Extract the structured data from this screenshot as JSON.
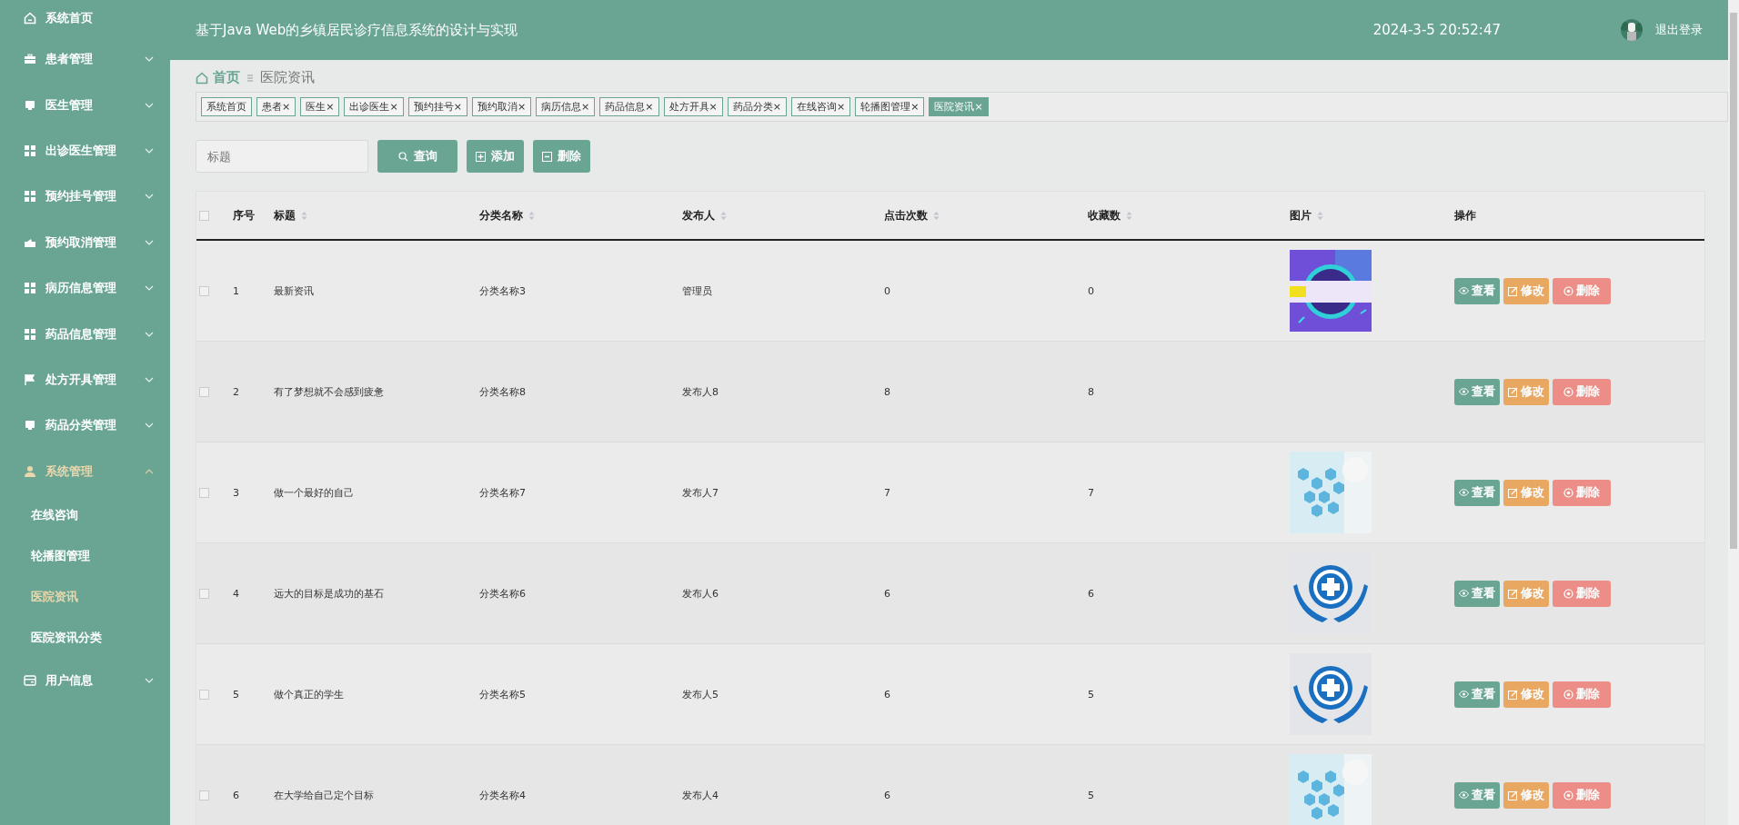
{
  "header": {
    "title": "基于Java Web的乡镇居民诊疗信息系统的设计与实现",
    "datetime": "2024-3-5 20:52:47",
    "logout": "退出登录"
  },
  "sidebar": {
    "items": [
      {
        "label": "系统首页"
      },
      {
        "label": "患者管理",
        "expanded": false
      },
      {
        "label": "医生管理",
        "expanded": false
      },
      {
        "label": "出诊医生管理",
        "expanded": false
      },
      {
        "label": "预约挂号管理",
        "expanded": false
      },
      {
        "label": "预约取消管理",
        "expanded": false
      },
      {
        "label": "病历信息管理",
        "expanded": false
      },
      {
        "label": "药品信息管理",
        "expanded": false
      },
      {
        "label": "处方开具管理",
        "expanded": false
      },
      {
        "label": "药品分类管理",
        "expanded": false
      },
      {
        "label": "系统管理",
        "expanded": true,
        "children": [
          {
            "label": "在线咨询",
            "selected": false
          },
          {
            "label": "轮播图管理",
            "selected": false
          },
          {
            "label": "医院资讯",
            "selected": true
          },
          {
            "label": "医院资讯分类",
            "selected": false
          }
        ]
      },
      {
        "label": "用户信息",
        "expanded": false
      }
    ]
  },
  "breadcrumb": [
    {
      "label": "首页"
    },
    {
      "label": "医院资讯"
    }
  ],
  "tags": [
    {
      "label": "系统首页",
      "selected": false
    },
    {
      "label": "患者",
      "close": "×",
      "selected": false
    },
    {
      "label": "医生",
      "close": "×",
      "selected": false
    },
    {
      "label": "出诊医生",
      "close": "×",
      "selected": false
    },
    {
      "label": "预约挂号",
      "close": "×",
      "selected": false
    },
    {
      "label": "预约取消",
      "close": "×",
      "selected": false
    },
    {
      "label": "病历信息",
      "close": "×",
      "selected": false
    },
    {
      "label": "药品信息",
      "close": "×",
      "selected": false
    },
    {
      "label": "处方开具",
      "close": "×",
      "selected": false
    },
    {
      "label": "药品分类",
      "close": "×",
      "selected": false
    },
    {
      "label": "在线咨询",
      "close": "×",
      "selected": false
    },
    {
      "label": "轮播图管理",
      "close": "×",
      "selected": false
    },
    {
      "label": "医院资讯",
      "close": "×",
      "selected": true
    }
  ],
  "search": {
    "placeholder": "标题",
    "buttons": [
      {
        "label": "查询",
        "kind": "search"
      },
      {
        "label": "添加",
        "kind": "add"
      },
      {
        "label": "删除",
        "kind": "delete"
      }
    ]
  },
  "table": {
    "all_checked": false,
    "columns": [
      {
        "label": "序号",
        "sortable": false
      },
      {
        "label": "标题",
        "sortable": true
      },
      {
        "label": "分类名称",
        "sortable": true
      },
      {
        "label": "发布人",
        "sortable": true
      },
      {
        "label": "点击次数",
        "sortable": true
      },
      {
        "label": "收藏数",
        "sortable": true
      },
      {
        "label": "图片",
        "sortable": true
      },
      {
        "label": "操作",
        "sortable": false
      }
    ],
    "rows": [
      {
        "checked": false,
        "index": "1",
        "title": "最新资讯",
        "category": "分类名称3",
        "publisher": "管理员",
        "clicks": "0",
        "favorites": "0",
        "image": {
          "kind": "picture"
        },
        "actions": [
          {
            "label": "查看",
            "kind": "view"
          },
          {
            "label": "修改",
            "kind": "edit"
          },
          {
            "label": "删除",
            "kind": "delete"
          }
        ]
      },
      {
        "checked": false,
        "index": "2",
        "title": "有了梦想就不会感到疲惫",
        "category": "分类名称8",
        "publisher": "发布人8",
        "clicks": "8",
        "favorites": "8",
        "actions": [
          {
            "label": "查看",
            "kind": "view"
          },
          {
            "label": "修改",
            "kind": "edit"
          },
          {
            "label": "删除",
            "kind": "delete"
          }
        ]
      },
      {
        "checked": false,
        "index": "3",
        "title": "做一个最好的自己",
        "category": "分类名称7",
        "publisher": "发布人7",
        "clicks": "7",
        "favorites": "7",
        "image": {
          "kind": "picture"
        },
        "actions": [
          {
            "label": "查看",
            "kind": "view"
          },
          {
            "label": "修改",
            "kind": "edit"
          },
          {
            "label": "删除",
            "kind": "delete"
          }
        ]
      },
      {
        "checked": false,
        "index": "4",
        "title": "远大的目标是成功的基石",
        "category": "分类名称6",
        "publisher": "发布人6",
        "clicks": "6",
        "favorites": "6",
        "image": {
          "kind": "picture"
        },
        "actions": [
          {
            "label": "查看",
            "kind": "view"
          },
          {
            "label": "修改",
            "kind": "edit"
          },
          {
            "label": "删除",
            "kind": "delete"
          }
        ]
      },
      {
        "checked": false,
        "index": "5",
        "title": "做个真正的学生",
        "category": "分类名称5",
        "publisher": "发布人5",
        "clicks": "6",
        "favorites": "5",
        "image": {
          "kind": "picture"
        },
        "actions": [
          {
            "label": "查看",
            "kind": "view"
          },
          {
            "label": "修改",
            "kind": "edit"
          },
          {
            "label": "删除",
            "kind": "delete"
          }
        ]
      },
      {
        "checked": false,
        "index": "6",
        "title": "在大学给自己定个目标",
        "category": "分类名称4",
        "publisher": "发布人4",
        "clicks": "6",
        "favorites": "5",
        "image": {
          "kind": "picture"
        },
        "actions": [
          {
            "label": "查看",
            "kind": "view"
          },
          {
            "label": "修改",
            "kind": "edit"
          },
          {
            "label": "删除",
            "kind": "delete"
          }
        ]
      }
    ]
  }
}
